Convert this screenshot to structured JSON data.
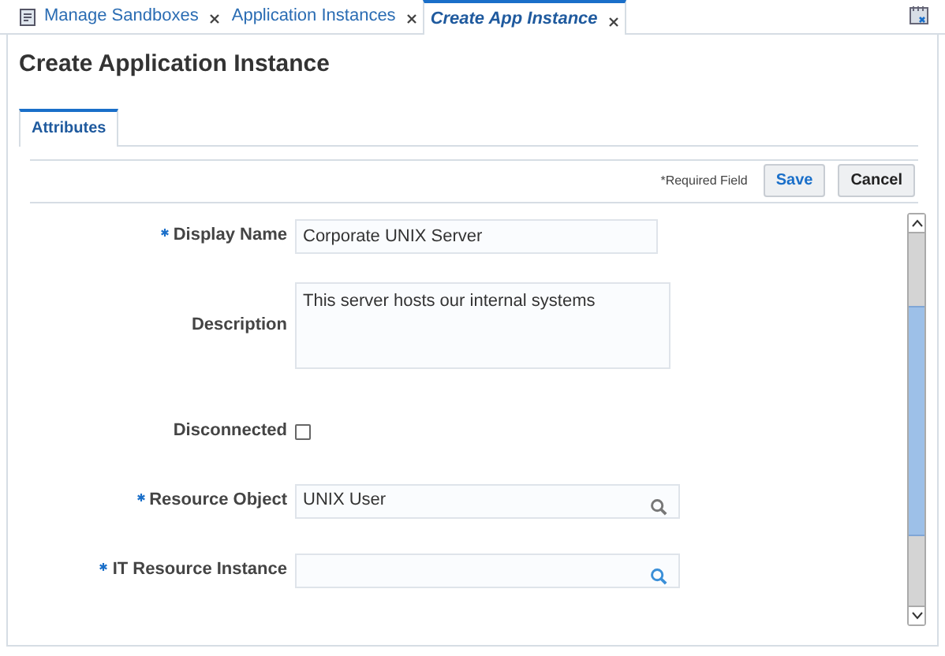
{
  "tabs": [
    {
      "label": "Manage Sandboxes",
      "selected": false,
      "icon": true
    },
    {
      "label": "Application Instances",
      "selected": false,
      "icon": false
    },
    {
      "label": "Create App Instance",
      "selected": true,
      "icon": false
    }
  ],
  "page": {
    "title": "Create Application Instance"
  },
  "subtabs": [
    {
      "label": "Attributes",
      "selected": true
    }
  ],
  "toolbar": {
    "required_note": "*Required Field",
    "buttons": [
      {
        "label": "Save",
        "kind": "primary"
      },
      {
        "label": "Cancel",
        "kind": "secondary"
      }
    ]
  },
  "form": {
    "fields": [
      {
        "kind": "text",
        "label": "Display Name",
        "required": true,
        "value": "Corporate UNIX Server"
      },
      {
        "kind": "textarea",
        "label": "Description",
        "required": false,
        "value": "This server hosts our internal systems"
      },
      {
        "kind": "checkbox",
        "label": "Disconnected",
        "required": false,
        "checked": false
      },
      {
        "kind": "lookup",
        "label": "Resource Object",
        "required": true,
        "value": "UNIX User"
      },
      {
        "kind": "lookup",
        "label": "IT Resource Instance",
        "required": true
      }
    ]
  }
}
